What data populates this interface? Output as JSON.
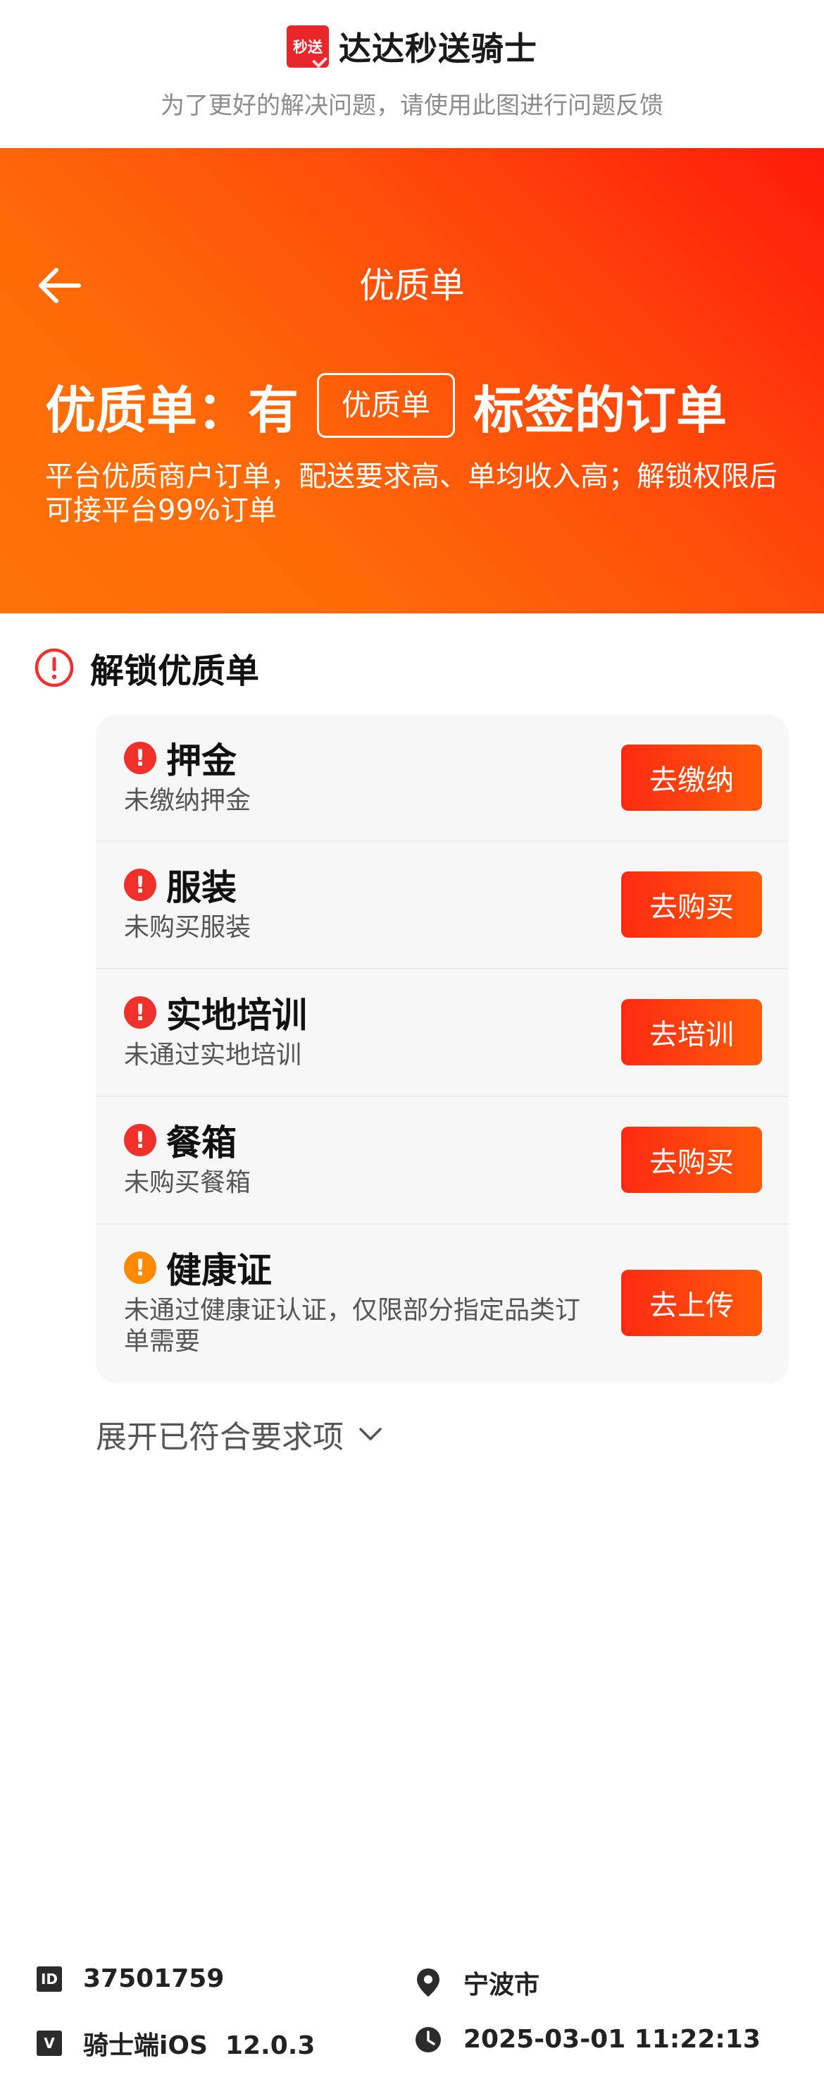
{
  "brand": {
    "logo_text": "秒送",
    "name": "达达秒送骑士",
    "tip": "为了更好的解决问题，请使用此图进行问题反馈"
  },
  "header": {
    "title": "优质单",
    "back_icon": "arrow-left-icon"
  },
  "hero": {
    "headline_prefix": "优质单：有",
    "tag_label": "优质单",
    "headline_suffix": "标签的订单",
    "description": "平台优质商户订单，配送要求高、单均收入高；解锁权限后可接平台99%订单",
    "gradient_colors": [
      "#ff1a0a",
      "#ff7209"
    ]
  },
  "unlock": {
    "title": "解锁优质单",
    "title_icon": "alert-circle-icon",
    "items": [
      {
        "title": "押金",
        "subtitle": "未缴纳押金",
        "button": "去缴纳",
        "status": "required"
      },
      {
        "title": "服装",
        "subtitle": "未购买服装",
        "button": "去购买",
        "status": "required"
      },
      {
        "title": "实地培训",
        "subtitle": "未通过实地培训",
        "button": "去培训",
        "status": "required"
      },
      {
        "title": "餐箱",
        "subtitle": "未购买餐箱",
        "button": "去购买",
        "status": "required"
      },
      {
        "title": "健康证",
        "subtitle": "未通过健康证认证，仅限部分指定品类订单需要",
        "button": "去上传",
        "status": "partial"
      }
    ],
    "expand_label": "展开已符合要求项"
  },
  "footer": {
    "id_badge": "ID",
    "id": "37501759",
    "city": "宁波市",
    "version_badge": "V",
    "version": "骑士端iOS  12.0.3",
    "time": "2025-03-01 11:22:13"
  },
  "colors": {
    "accent": "#ff4d0a",
    "alert_red": "#f0302b",
    "alert_amber": "#ff8a00"
  }
}
